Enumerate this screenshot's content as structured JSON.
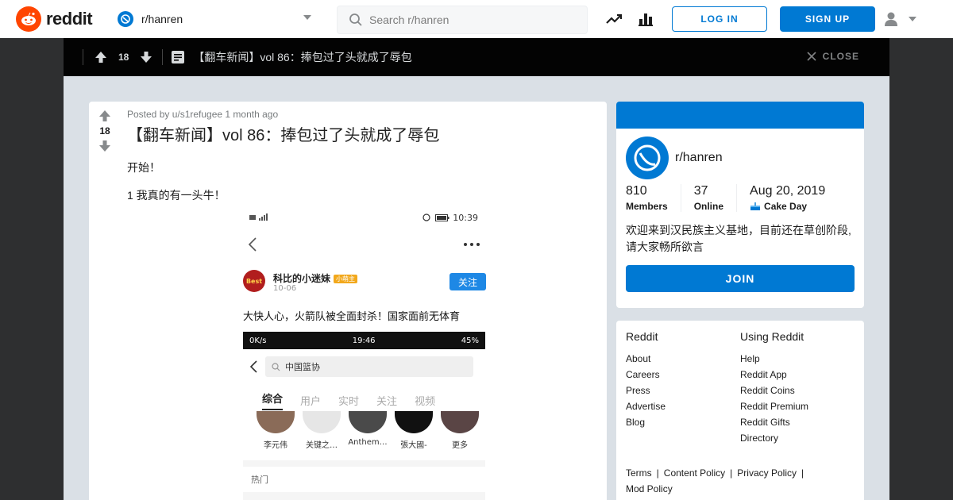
{
  "header": {
    "logo_text": "reddit",
    "subreddit": "r/hanren",
    "search_placeholder": "Search r/hanren",
    "login_label": "LOG IN",
    "signup_label": "SIGN UP"
  },
  "postbar": {
    "votes": "18",
    "title": "【翻车新闻】vol 86：捧包过了头就成了辱包",
    "close_label": "CLOSE"
  },
  "post": {
    "votes": "18",
    "meta": "Posted by u/s1refugee 1 month ago",
    "title": "【翻车新闻】vol 86：捧包过了头就成了辱包",
    "line1": "开始！",
    "line2": "1 我真的有一头牛！"
  },
  "screenshot": {
    "time": "10:39",
    "username": "科比的小迷妹",
    "user_badge": "小萌主",
    "date": "10-06",
    "follow": "关注",
    "caption": "大快人心，火箭队被全面封杀！国家面前无体育",
    "inner_time": "19:46",
    "inner_speed": "0K/s",
    "inner_battery": "45%",
    "inner_search": "中国篮协",
    "tabs": [
      "综合",
      "用户",
      "实时",
      "关注",
      "视频"
    ],
    "avatars": [
      "李元伟",
      "关键之…",
      "Anthem…",
      "張大國-",
      "更多"
    ],
    "hot": "热门"
  },
  "community": {
    "name": "r/hanren",
    "members_value": "810",
    "members_label": "Members",
    "online_value": "37",
    "online_label": "Online",
    "cake_value": "Aug 20, 2019",
    "cake_label": "Cake Day",
    "description": "欢迎来到汉民族主义基地，目前还在草创阶段,请大家畅所欲言",
    "join_label": "JOIN"
  },
  "footer": {
    "col1_title": "Reddit",
    "col1_links": [
      "About",
      "Careers",
      "Press",
      "Advertise",
      "Blog"
    ],
    "col2_title": "Using Reddit",
    "col2_links": [
      "Help",
      "Reddit App",
      "Reddit Coins",
      "Reddit Premium",
      "Reddit Gifts",
      "Directory"
    ],
    "policy_links": [
      "Terms",
      "Content Policy",
      "Privacy Policy",
      "Mod Policy"
    ]
  },
  "colors": {
    "accent": "#0079d3",
    "brand": "#ff4500",
    "overlay": "#030303",
    "content_bg": "#dae0e6"
  }
}
